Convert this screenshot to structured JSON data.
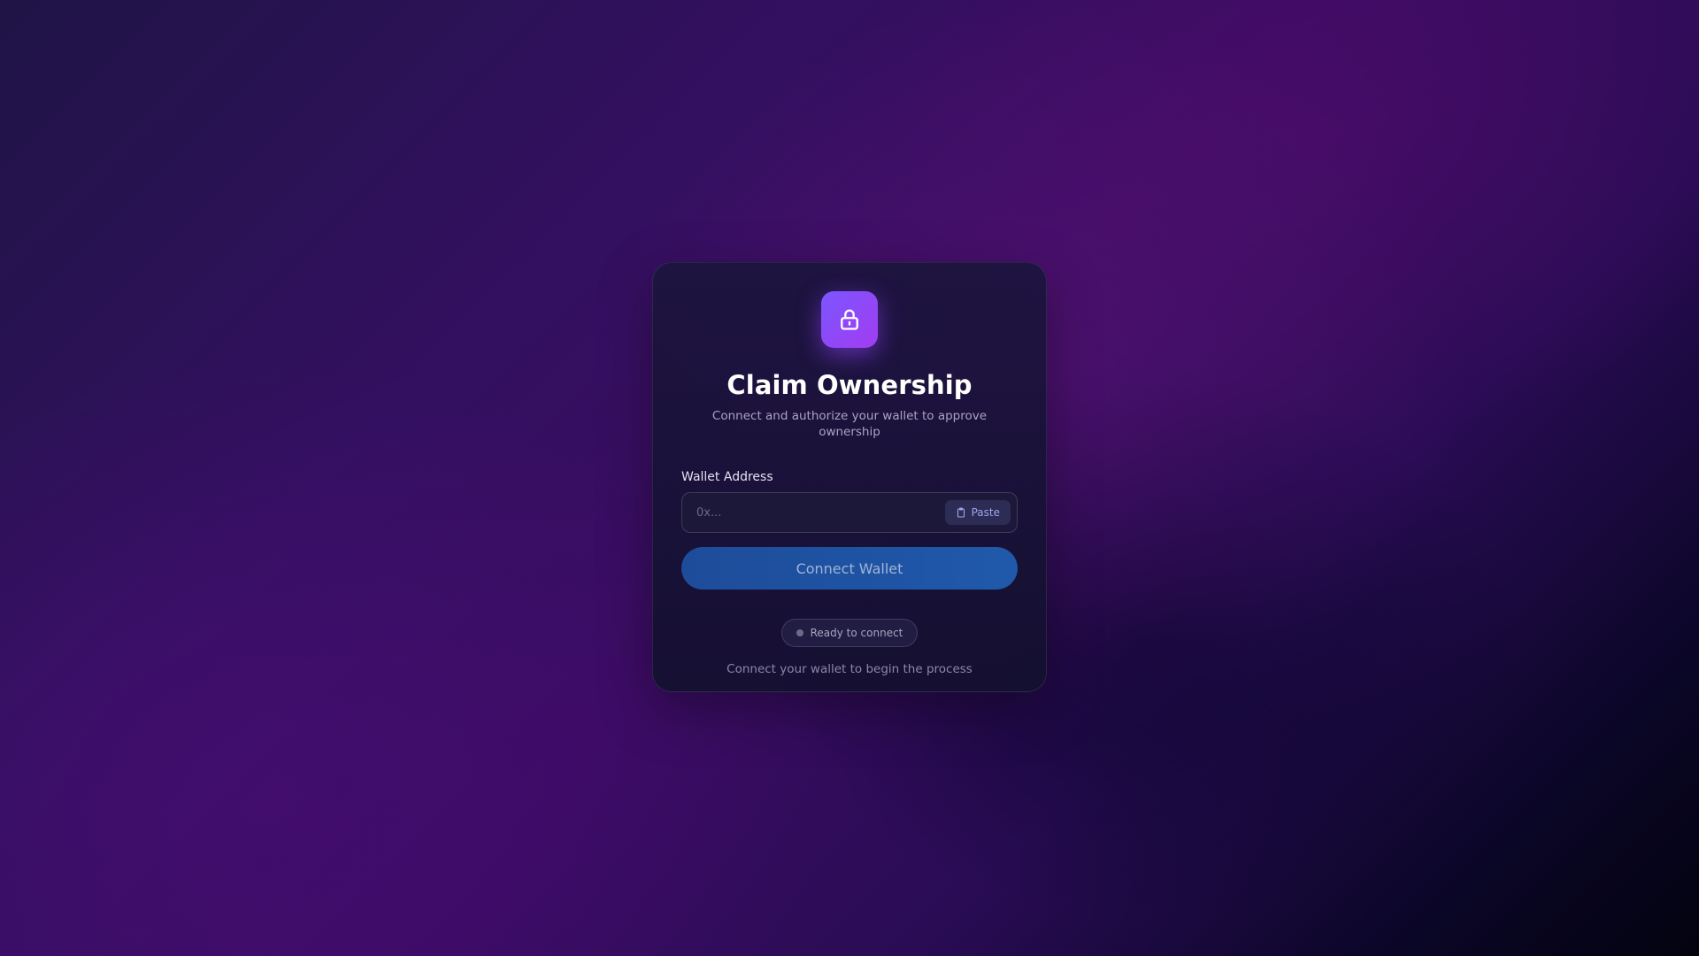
{
  "card": {
    "title": "Claim Ownership",
    "subtitle": "Connect and authorize your wallet to approve ownership",
    "icon": "lock-icon"
  },
  "wallet_field": {
    "label": "Wallet Address",
    "value": "",
    "placeholder": "0x...",
    "paste_label": "Paste",
    "paste_icon": "clipboard-icon"
  },
  "connect_button": {
    "label": "Connect Wallet"
  },
  "status": {
    "text": "Ready to connect",
    "dot_color": "#6c6a86"
  },
  "helper_text": "Connect your wallet to begin the process",
  "colors": {
    "accent_gradient_start": "#7a56ff",
    "accent_gradient_end": "#a33cf1",
    "button_blue": "#1d4c9a",
    "card_bg": "#1c143e"
  }
}
